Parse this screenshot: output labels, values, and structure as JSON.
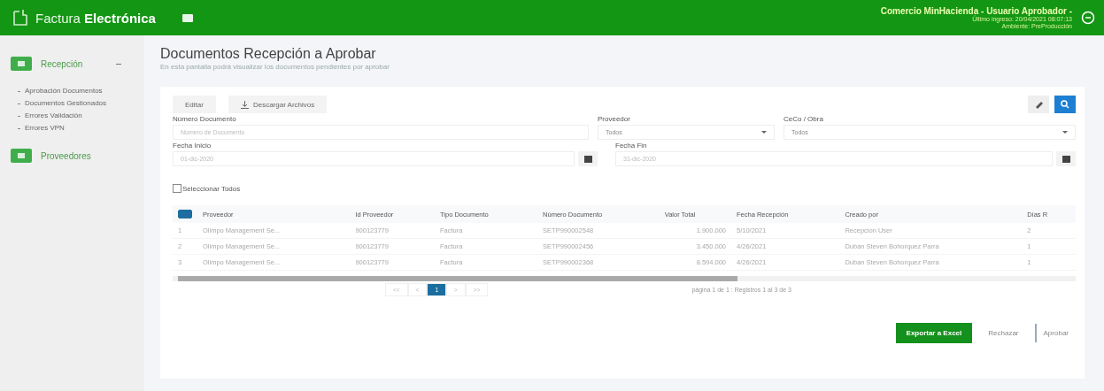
{
  "header": {
    "brand": "Factura",
    "brand_bold": "Electrónica",
    "user": "Comercio MinHacienda - Usuario Aprobador -",
    "last_login": "Último ingreso: 20/04/2021 08:07:13",
    "environment": "Ambiente: PreProducción"
  },
  "sidebar": {
    "sections": [
      {
        "label": "Recepción",
        "expanded": true,
        "children": [
          {
            "label": "Aprobación Documentos"
          },
          {
            "label": "Documentos Gestionados"
          },
          {
            "label": "Errores Validación"
          },
          {
            "label": "Errores VPN"
          }
        ]
      },
      {
        "label": "Proveedores",
        "expanded": false
      }
    ]
  },
  "page": {
    "title": "Documentos Recepción a Aprobar",
    "subtitle": "En esta pantalla podrá visualizar los documentos pendientes por aprobar"
  },
  "toolbar": {
    "buttons": [
      "Editar",
      "Descargar Archivos"
    ]
  },
  "filters": [
    {
      "label": "Número Documento",
      "placeholder": "Número de Documento",
      "kind": "text"
    },
    {
      "label": "Proveedor",
      "value": "Todos",
      "kind": "select"
    },
    {
      "label": "CeCo / Obra",
      "value": "Todos",
      "kind": "select"
    },
    {
      "label": "Fecha Inicio",
      "placeholder": "01-dic-2020",
      "kind": "date"
    },
    {
      "label": "Fecha Fin",
      "placeholder": "31-dic-2020",
      "kind": "date"
    }
  ],
  "select_all": {
    "label": "Seleccionar Todos",
    "checked": false
  },
  "table": {
    "columns": [
      {
        "kind": "checkbox",
        "checked": true
      },
      {
        "kind": "text",
        "label": "Proveedor"
      },
      {
        "kind": "text",
        "label": "Id Proveedor"
      },
      {
        "kind": "text",
        "label": "Tipo Documento"
      },
      {
        "kind": "text",
        "label": "Número Documento"
      },
      {
        "kind": "text",
        "label": "Valor Total"
      },
      {
        "kind": "text",
        "label": "Fecha Recepción"
      },
      {
        "kind": "text",
        "label": "Creado por"
      },
      {
        "kind": "text",
        "label": "Días R"
      }
    ],
    "rows": [
      [
        "1",
        "Olimpo Management Se...",
        "900123779",
        "Factura",
        "SETP990002548",
        "1.900.000",
        "5/10/2021",
        "Recepcion User",
        "2"
      ],
      [
        "2",
        "Olimpo Management Se...",
        "900123779",
        "Factura",
        "SETP990002456",
        "3.450.000",
        "4/26/2021",
        "Duban Steven Bohorquez Parra",
        "1"
      ],
      [
        "3",
        "Olimpo Management Se...",
        "900123779",
        "Factura",
        "SETP990002368",
        "8.594.000",
        "4/26/2021",
        "Duban Steven Bohorquez Parra",
        "1"
      ]
    ]
  },
  "pagination": {
    "pages": [
      {
        "label": "<<",
        "selected": false
      },
      {
        "label": "<",
        "selected": false
      },
      {
        "label": "1",
        "selected": true
      },
      {
        "label": ">",
        "selected": false
      },
      {
        "label": ">>",
        "selected": false
      }
    ],
    "summary": "página 1 de 1 : Registros 1 al 3 de 3"
  },
  "actions": [
    "Exportar a Excel",
    "Rechazar",
    "Aprobar"
  ]
}
